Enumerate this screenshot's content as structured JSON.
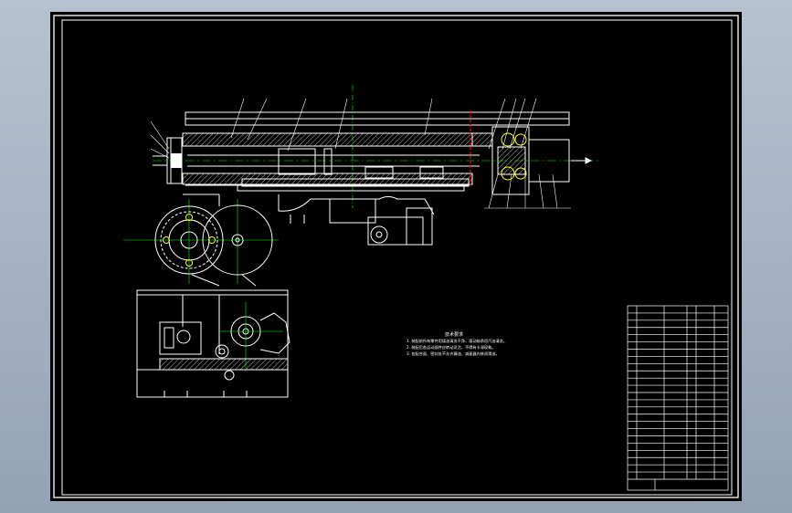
{
  "canvas": {
    "background": "#000000",
    "workspace_color": "#a4b1c3"
  },
  "colors": {
    "line": "#ffffff",
    "center_line": "#00ff00",
    "highlight": "#ffff00",
    "section_cut": "#ff0000"
  },
  "notes": {
    "heading": "技术要求",
    "lines": [
      "1. 装配前所有零件用煤油清洗干净，滚动轴承用汽油清洗。",
      "2. 装配后各运动部件应转动灵活，不得有卡滞现象。",
      "3. 各配合面、密封处不允许漏油，减速器内装润滑油。"
    ]
  },
  "title_block": {
    "row_count": 24
  }
}
